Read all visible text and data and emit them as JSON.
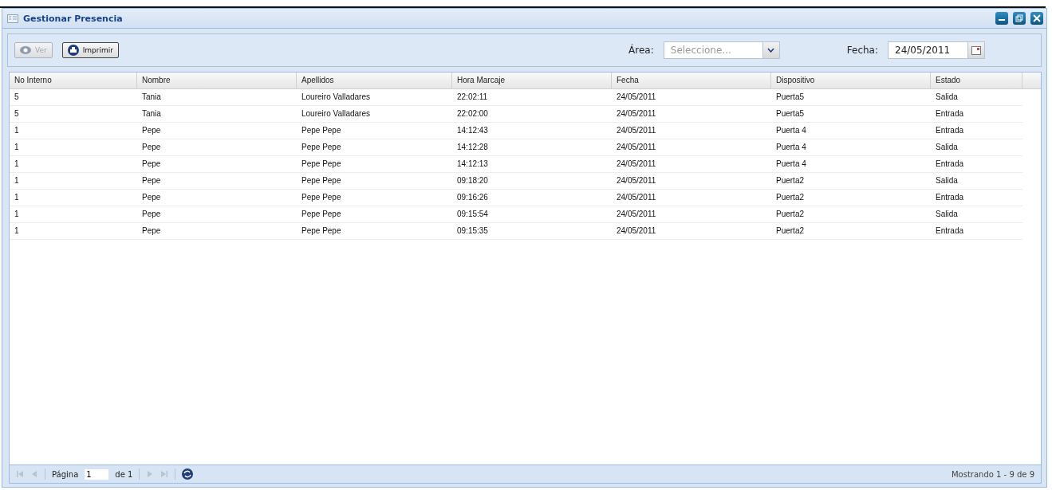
{
  "window": {
    "title": "Gestionar Presencia"
  },
  "toolbar": {
    "buttons": [
      {
        "label": "Ver",
        "kind": "view",
        "disabled": true
      },
      {
        "label": "Imprimir",
        "kind": "print",
        "disabled": false
      }
    ],
    "area": {
      "label": "Área:",
      "placeholder": "Seleccione..."
    },
    "date": {
      "label": "Fecha:",
      "value": "24/05/2011"
    }
  },
  "table": {
    "columns": [
      "No Interno",
      "Nombre",
      "Apellidos",
      "Hora Marcaje",
      "Fecha",
      "Dispositivo",
      "Estado"
    ],
    "rows": [
      [
        "5",
        "Tania",
        "Loureiro Valladares",
        "22:02:11",
        "24/05/2011",
        "Puerta5",
        "Salida"
      ],
      [
        "5",
        "Tania",
        "Loureiro Valladares",
        "22:02:00",
        "24/05/2011",
        "Puerta5",
        "Entrada"
      ],
      [
        "1",
        "Pepe",
        "Pepe Pepe",
        "14:12:43",
        "24/05/2011",
        "Puerta 4",
        "Entrada"
      ],
      [
        "1",
        "Pepe",
        "Pepe Pepe",
        "14:12:28",
        "24/05/2011",
        "Puerta 4",
        "Salida"
      ],
      [
        "1",
        "Pepe",
        "Pepe Pepe",
        "14:12:13",
        "24/05/2011",
        "Puerta 4",
        "Entrada"
      ],
      [
        "1",
        "Pepe",
        "Pepe Pepe",
        "09:18:20",
        "24/05/2011",
        "Puerta2",
        "Salida"
      ],
      [
        "1",
        "Pepe",
        "Pepe Pepe",
        "09:16:26",
        "24/05/2011",
        "Puerta2",
        "Entrada"
      ],
      [
        "1",
        "Pepe",
        "Pepe Pepe",
        "09:15:54",
        "24/05/2011",
        "Puerta2",
        "Salida"
      ],
      [
        "1",
        "Pepe",
        "Pepe Pepe",
        "09:15:35",
        "24/05/2011",
        "Puerta2",
        "Entrada"
      ]
    ]
  },
  "pager": {
    "page_label": "Página",
    "page": "1",
    "of_label": "de 1",
    "summary": "Mostrando 1 - 9 de 9"
  }
}
